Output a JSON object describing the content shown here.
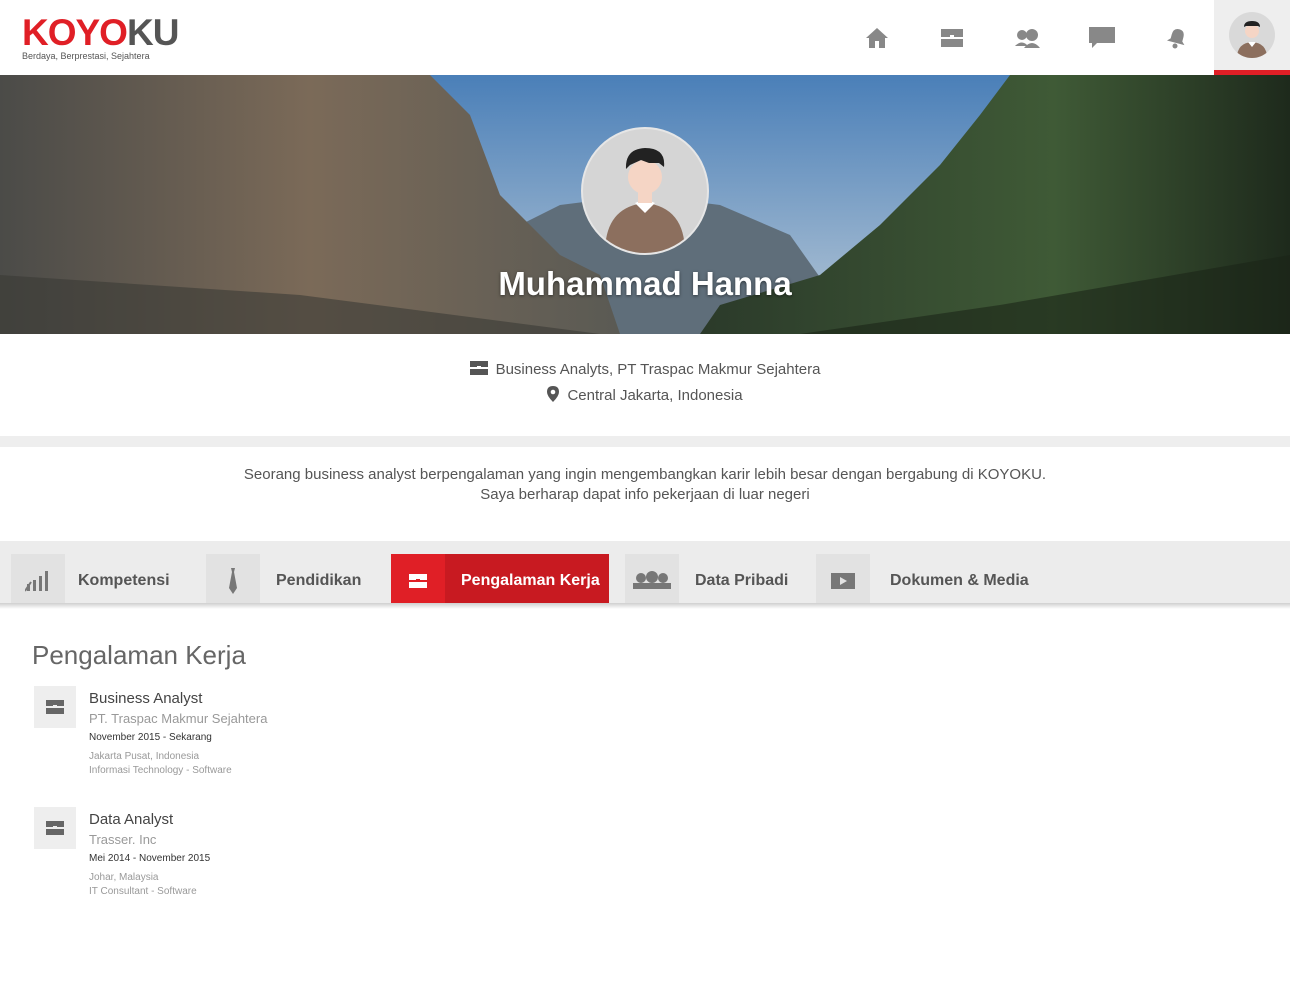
{
  "header": {
    "logo_red": "KOYO",
    "logo_dark": "KU",
    "tagline": "Berdaya, Berprestasi, Sejahtera",
    "nav": [
      "home-icon",
      "briefcase-icon",
      "people-icon",
      "chat-icon",
      "bell-icon"
    ]
  },
  "profile": {
    "name": "Muhammad Hanna",
    "job": "Business Analyts,  PT Traspac Makmur Sejahtera",
    "location": "Central Jakarta, Indonesia",
    "bio_line1": "Seorang business  analyst berpengalaman yang ingin mengembangkan karir lebih besar dengan bergabung di KOYOKU.",
    "bio_line2": "Saya berharap dapat info pekerjaan di luar negeri"
  },
  "tabs": [
    {
      "label": "Kompetensi",
      "icon": "chart-icon"
    },
    {
      "label": "Pendidikan",
      "icon": "tie-icon"
    },
    {
      "label": "Pengalaman Kerja",
      "icon": "briefcase-icon"
    },
    {
      "label": "Data Pribadi",
      "icon": "people-icon"
    },
    {
      "label": "Dokumen & Media",
      "icon": "play-icon"
    }
  ],
  "active_tab": "Pengalaman Kerja",
  "colors": {
    "accent": "#e01f26",
    "accent_dark": "#c81a21"
  },
  "section": {
    "title": "Pengalaman Kerja",
    "jobs": [
      {
        "title": "Business Analyst",
        "company": "PT. Traspac Makmur Sejahtera",
        "period": "November 2015 - Sekarang",
        "location": "Jakarta Pusat, Indonesia",
        "industry": "Informasi Technology - Software"
      },
      {
        "title": "Data Analyst",
        "company": "Trasser. Inc",
        "period": "Mei 2014 - November 2015",
        "location": "Johar, Malaysia",
        "industry": "IT Consultant - Software"
      }
    ]
  }
}
